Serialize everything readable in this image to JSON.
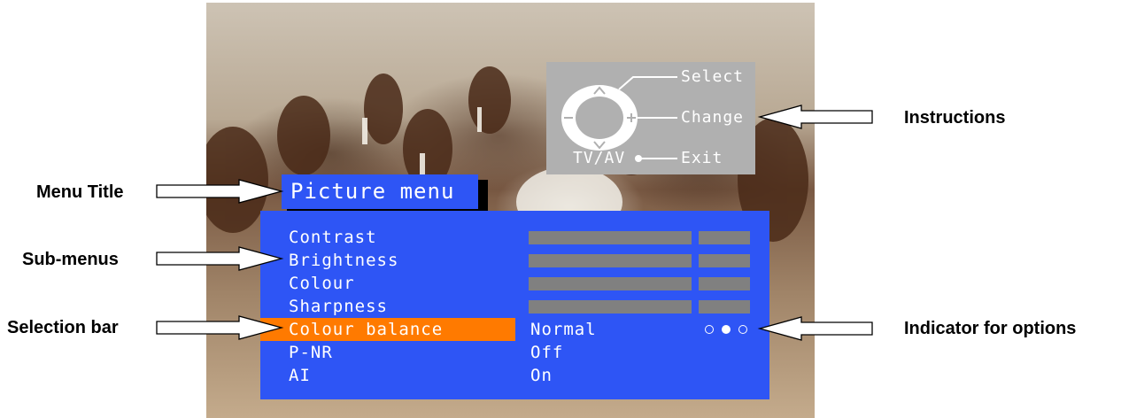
{
  "menu": {
    "title": "Picture menu",
    "items": [
      {
        "label": "Contrast",
        "type": "slider"
      },
      {
        "label": "Brightness",
        "type": "slider"
      },
      {
        "label": "Colour",
        "type": "slider"
      },
      {
        "label": "Sharpness",
        "type": "slider"
      },
      {
        "label": "Colour balance",
        "type": "option",
        "value": "Normal",
        "selected": true,
        "options_count": 3,
        "current_option": 2
      },
      {
        "label": "P-NR",
        "type": "option",
        "value": "Off"
      },
      {
        "label": "AI",
        "type": "option",
        "value": "On"
      }
    ]
  },
  "instructions": {
    "select": "Select",
    "change": "Change",
    "exit": "Exit",
    "tv_av": "TV/AV",
    "remote_icon": "navigation-pad-icon"
  },
  "callouts": {
    "menu_title": "Menu Title",
    "sub_menus": "Sub-menus",
    "selection_bar": "Selection bar",
    "instructions": "Instructions",
    "indicator": "Indicator for options"
  },
  "colors": {
    "menu_blue": "#2e55f5",
    "selection_orange": "#ff7a00",
    "slider_gray": "#808080",
    "instruction_gray": "#b0b0b0"
  }
}
